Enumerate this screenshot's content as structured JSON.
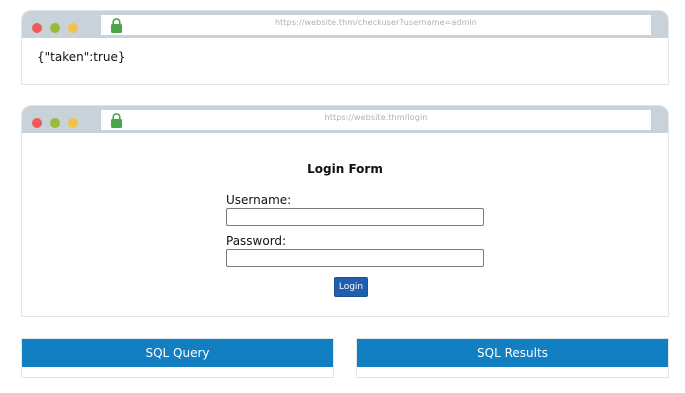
{
  "colors": {
    "window_bar": "#c9d1d9",
    "dot_red": "#f05a5a",
    "dot_green": "#9bba3b",
    "dot_yellow": "#f3c349",
    "lock_green": "#4aa64a",
    "login_button": "#1f5fae",
    "panel_header": "#117fc1"
  },
  "windows": [
    {
      "address": "https://website.thm/checkuser?username=admin",
      "content": "{\"taken\":true}"
    },
    {
      "address": "https://website.thm/login"
    }
  ],
  "login_form": {
    "title": "Login Form",
    "username_label": "Username:",
    "username_value": "",
    "password_label": "Password:",
    "password_value": "",
    "button_label": "Login"
  },
  "panels": {
    "sql_query": "SQL Query",
    "sql_results": "SQL Results"
  }
}
